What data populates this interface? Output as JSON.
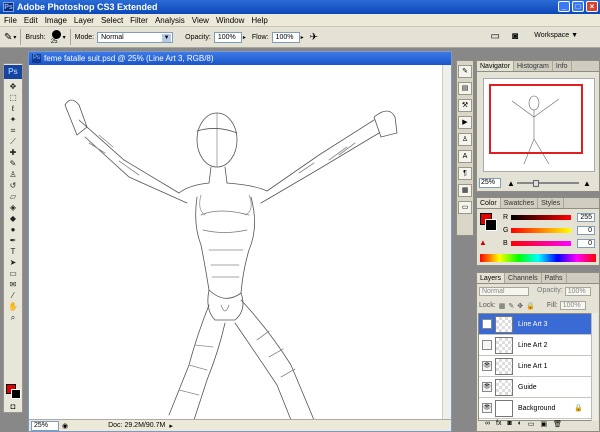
{
  "app": {
    "title": "Adobe Photoshop CS3 Extended",
    "icon": "Ps"
  },
  "menu": [
    "File",
    "Edit",
    "Image",
    "Layer",
    "Select",
    "Filter",
    "Analysis",
    "View",
    "Window",
    "Help"
  ],
  "options": {
    "brush_label": "Brush:",
    "brush_size": "25",
    "mode_label": "Mode:",
    "mode_value": "Normal",
    "opacity_label": "Opacity:",
    "opacity_value": "100%",
    "flow_label": "Flow:",
    "flow_value": "100%",
    "workspace_label": "Workspace ▼"
  },
  "document": {
    "title": "feme fatalle suit.psd @ 25% (Line Art 3, RGB/8)",
    "zoom": "25%",
    "doc_info": "Doc: 29.2M/90.7M"
  },
  "navigator": {
    "tabs": [
      "Navigator",
      "Histogram",
      "Info"
    ],
    "zoom": "25%"
  },
  "color": {
    "tabs": [
      "Color",
      "Swatches",
      "Styles"
    ],
    "channels": [
      {
        "label": "R",
        "value": "255"
      },
      {
        "label": "G",
        "value": "0"
      },
      {
        "label": "B",
        "value": "0"
      }
    ],
    "foreground": "#e00000",
    "background": "#000000"
  },
  "layers_panel": {
    "tabs": [
      "Layers",
      "Channels",
      "Paths"
    ],
    "blend_mode": "Normal",
    "opacity_label": "Opacity:",
    "opacity_value": "100%",
    "lock_label": "Lock:",
    "fill_label": "Fill:",
    "fill_value": "100%",
    "layers": [
      {
        "name": "Line Art 3",
        "selected": true,
        "visible": false
      },
      {
        "name": "Line Art 2",
        "selected": false,
        "visible": false
      },
      {
        "name": "Line Art 1",
        "selected": false,
        "visible": true
      },
      {
        "name": "Guide",
        "selected": false,
        "visible": true
      },
      {
        "name": "Background",
        "selected": false,
        "visible": true
      }
    ]
  }
}
